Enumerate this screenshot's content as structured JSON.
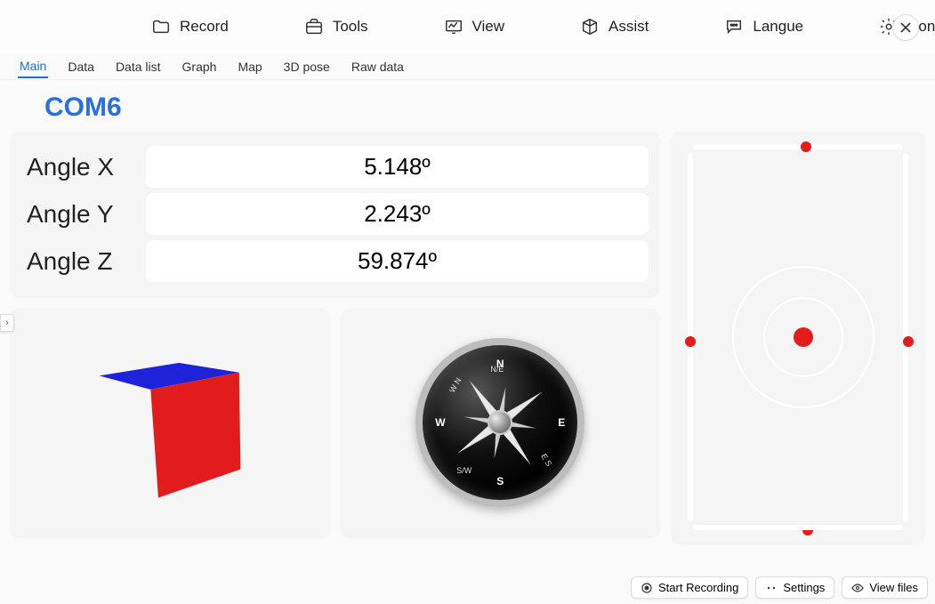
{
  "toolbar": {
    "record": "Record",
    "tools": "Tools",
    "view": "View",
    "assist": "Assist",
    "langue": "Langue",
    "config": "Config"
  },
  "tabs": {
    "main": "Main",
    "data": "Data",
    "data_list": "Data list",
    "graph": "Graph",
    "map": "Map",
    "pose": "3D pose",
    "raw": "Raw data",
    "active": "main"
  },
  "port": "COM6",
  "angles": {
    "x_label": "Angle X",
    "y_label": "Angle Y",
    "z_label": "Angle Z",
    "x_value": "5.148º",
    "y_value": "2.243º",
    "z_value": "59.874º"
  },
  "compass": {
    "n": "N",
    "e": "E",
    "s": "S",
    "w": "W",
    "ne": "N/E",
    "es": "E S",
    "sw": "S/W",
    "wn": "W N"
  },
  "footer": {
    "start_recording": "Start Recording",
    "settings": "Settings",
    "view_files": "View files"
  }
}
